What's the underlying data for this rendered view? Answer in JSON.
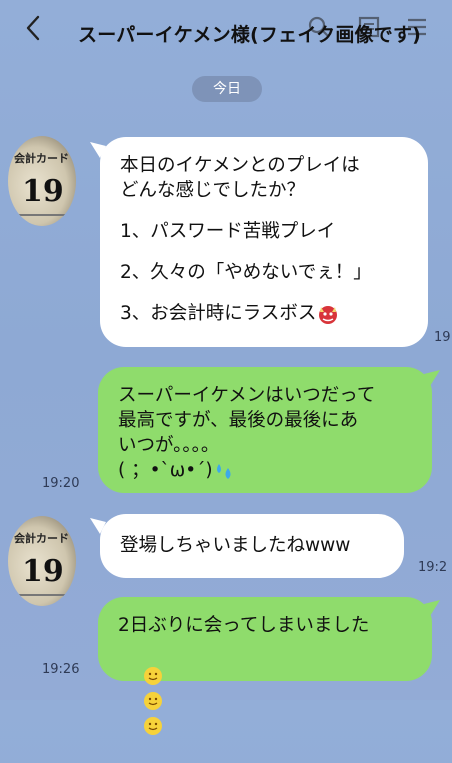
{
  "header": {
    "title": "スーパーイケメン様(フェイク画像です)"
  },
  "date_separator": "今日",
  "avatar": {
    "card_label": "会計カード",
    "number": "19"
  },
  "messages": [
    {
      "side": "received",
      "lines": [
        "本日のイケメンとのプレイは",
        "どんな感じでしたか？"
      ],
      "time": "19:",
      "items": [
        "1、パスワード苦戦プレイ",
        "2、久々の「やめないでぇ！」",
        "3、お会計時にラスボス"
      ]
    },
    {
      "side": "sent",
      "lines": [
        "スーパーイケメンはいつだって",
        "最高ですが、最後の最後にあ",
        "いつが。。。。",
        "( ；•`ω•´)"
      ],
      "time": "19:20"
    },
    {
      "side": "received",
      "text": "登場しちゃいましたねwww",
      "time": "19:2"
    },
    {
      "side": "sent",
      "text": "2日ぶりに会ってしまいました",
      "time": "19:26"
    }
  ]
}
